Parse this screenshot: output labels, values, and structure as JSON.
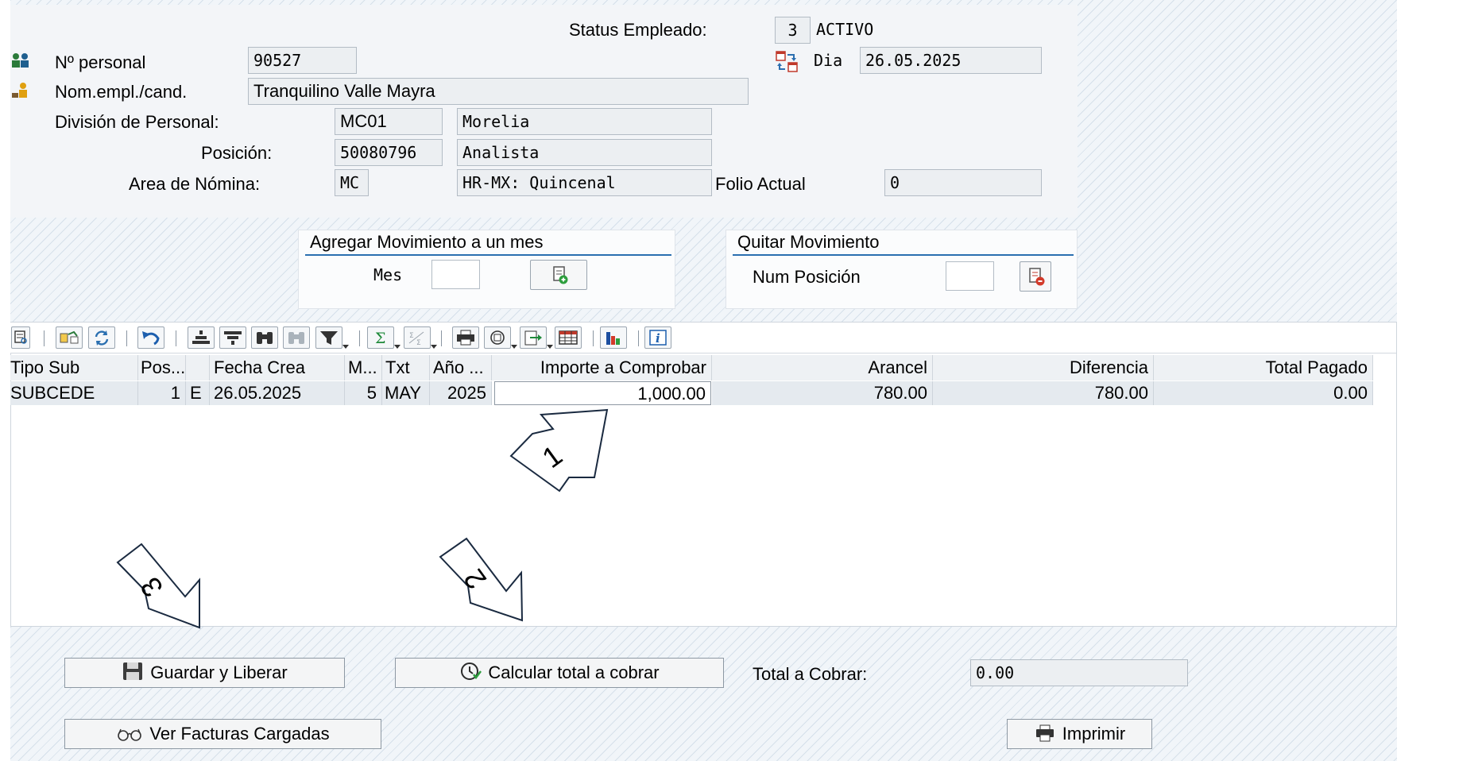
{
  "header": {
    "status_label": "Status Empleado:",
    "status_code": "3",
    "status_text": "ACTIVO",
    "dia_label": "Dia",
    "dia_value": "26.05.2025",
    "personal_label": "Nº personal",
    "personal_value": "90527",
    "nombre_label": "Nom.empl./cand.",
    "nombre_value": "Tranquilino Valle Mayra",
    "division_label": "División de Personal:",
    "division_code": "MC01",
    "division_text": "Morelia",
    "posicion_label": "Posición:",
    "posicion_code": "50080796",
    "posicion_text": "Analista",
    "area_label": "Area de Nómina:",
    "area_code": "MC",
    "area_text": "HR-MX: Quincenal",
    "folio_label": "Folio Actual",
    "folio_value": "0"
  },
  "agregar": {
    "title": "Agregar Movimiento a un mes",
    "mes_label": "Mes",
    "mes_value": ""
  },
  "quitar": {
    "title": "Quitar Movimiento",
    "num_label": "Num Posición",
    "num_value": ""
  },
  "table": {
    "columns": [
      "Tipo Sub",
      "Pos...",
      "",
      "Fecha Crea",
      "M...",
      "Txt",
      "Año ...",
      "Importe a Comprobar",
      "Arancel",
      "Diferencia",
      "Total Pagado"
    ],
    "rows": [
      [
        "SUBCEDE",
        "1",
        "E",
        "26.05.2025",
        "5",
        "MAY",
        "2025",
        "1,000.00",
        "780.00",
        "780.00",
        "0.00"
      ]
    ]
  },
  "annotations": [
    "1",
    "2",
    "3"
  ],
  "footer": {
    "guardar_label": "Guardar y Liberar",
    "calcular_label": "Calcular total a cobrar",
    "total_label": "Total a Cobrar:",
    "total_value": "0.00",
    "ver_label": "Ver Facturas Cargadas",
    "imprimir_label": "Imprimir"
  },
  "colors": {
    "accent_line": "#2a6fb0",
    "hatch": "#96afc8",
    "field_bg": "#eceff2"
  }
}
